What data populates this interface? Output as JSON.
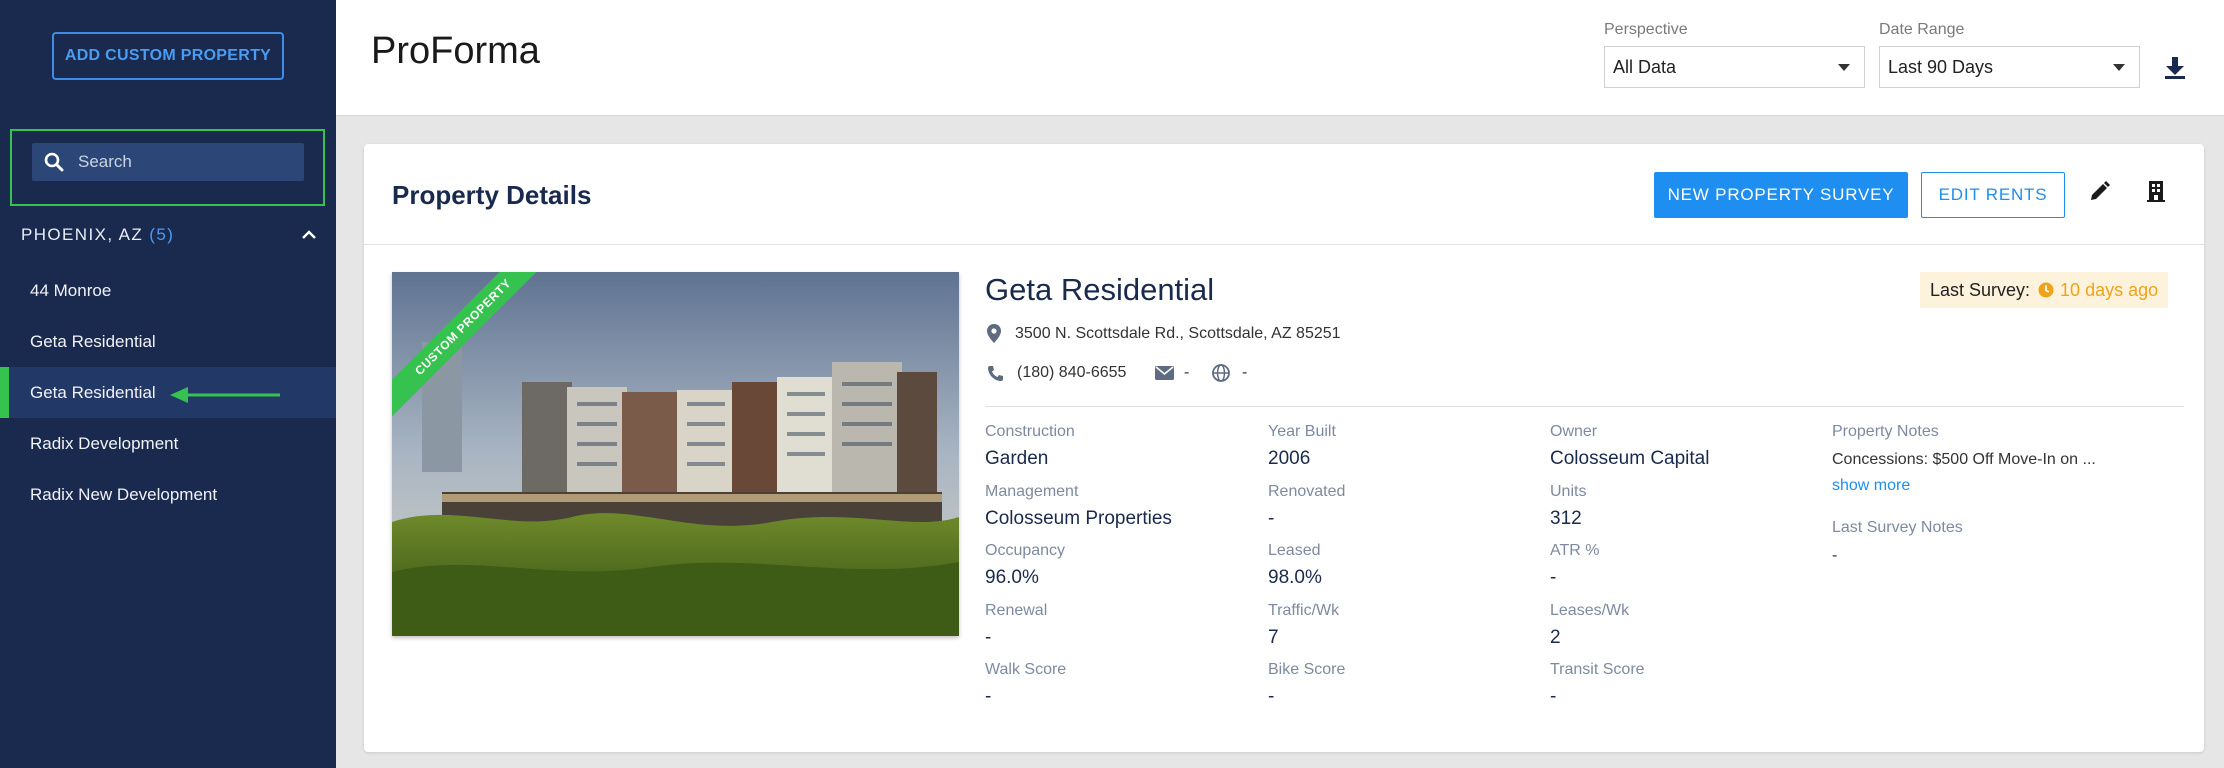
{
  "sidebar": {
    "add_button": "ADD CUSTOM PROPERTY",
    "search_placeholder": "Search",
    "region": {
      "label": "PHOENIX, AZ",
      "count": "(5)"
    },
    "items": [
      {
        "label": "44 Monroe",
        "active": false
      },
      {
        "label": "Geta Residential",
        "active": false
      },
      {
        "label": "Geta Residential",
        "active": true
      },
      {
        "label": "Radix Development",
        "active": false
      },
      {
        "label": "Radix New Development",
        "active": false
      }
    ]
  },
  "header": {
    "title": "ProForma",
    "perspective": {
      "label": "Perspective",
      "value": "All Data"
    },
    "date_range": {
      "label": "Date Range",
      "value": "Last 90 Days"
    }
  },
  "card": {
    "title": "Property Details",
    "new_survey_button": "NEW PROPERTY SURVEY",
    "edit_rents_button": "EDIT RENTS"
  },
  "property": {
    "ribbon": "CUSTOM PROPERTY",
    "name": "Geta Residential",
    "last_survey_label": "Last Survey:",
    "last_survey_value": "10 days ago",
    "address": "3500 N. Scottsdale Rd., Scottsdale, AZ 85251",
    "phone": "(180) 840-6655",
    "email": "-",
    "website": "-",
    "fields": {
      "construction": {
        "label": "Construction",
        "value": "Garden"
      },
      "management": {
        "label": "Management",
        "value": "Colosseum Properties"
      },
      "occupancy": {
        "label": "Occupancy",
        "value": "96.0%"
      },
      "renewal": {
        "label": "Renewal",
        "value": "-"
      },
      "walk_score": {
        "label": "Walk Score",
        "value": "-"
      },
      "year_built": {
        "label": "Year Built",
        "value": "2006"
      },
      "renovated": {
        "label": "Renovated",
        "value": "-"
      },
      "leased": {
        "label": "Leased",
        "value": "98.0%"
      },
      "traffic": {
        "label": "Traffic/Wk",
        "value": "7"
      },
      "bike_score": {
        "label": "Bike Score",
        "value": "-"
      },
      "owner": {
        "label": "Owner",
        "value": "Colosseum Capital"
      },
      "units": {
        "label": "Units",
        "value": "312"
      },
      "atr": {
        "label": "ATR %",
        "value": "-"
      },
      "leases_wk": {
        "label": "Leases/Wk",
        "value": "2"
      },
      "transit_score": {
        "label": "Transit Score",
        "value": "-"
      }
    },
    "notes": {
      "label": "Property Notes",
      "value": "Concessions: $500 Off Move-In on ...",
      "show_more": "show more",
      "survey_label": "Last Survey Notes",
      "survey_value": "-"
    }
  },
  "colors": {
    "sidebar_bg": "#1a2a4e",
    "accent_blue": "#1e8ef0",
    "accent_green": "#35c24f",
    "warning_orange": "#f0a21b"
  }
}
